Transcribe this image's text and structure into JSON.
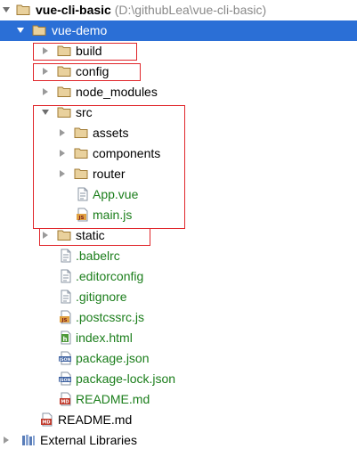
{
  "tree": {
    "root": {
      "name": "vue-cli-basic",
      "path": "(D:\\githubLea\\vue-cli-basic)"
    },
    "project": {
      "name": "vue-demo"
    },
    "items": {
      "build": "build",
      "config": "config",
      "node_modules": "node_modules",
      "src": "src",
      "assets": "assets",
      "components": "components",
      "router": "router",
      "app_vue": "App.vue",
      "main_js": "main.js",
      "static": "static",
      "babelrc": ".babelrc",
      "editorconfig": ".editorconfig",
      "gitignore": ".gitignore",
      "postcssrc": ".postcssrc.js",
      "index_html": "index.html",
      "package_json": "package.json",
      "package_lock": "package-lock.json",
      "readme_inner": "README.md",
      "readme_outer": "README.md",
      "external_libraries": "External Libraries"
    }
  },
  "colors": {
    "selection": "#2b6fd6",
    "folder": "#d9b66b",
    "highlight_box": "#e0262b",
    "modified_text": "#1b7e1b"
  },
  "icons": {
    "folder": "folder-icon",
    "vue_file": "vue-file-icon",
    "js_file": "js-file-icon",
    "config_file": "text-file-icon",
    "html_file": "html-file-icon",
    "json_file": "json-file-icon",
    "markdown_file": "markdown-file-icon",
    "library": "library-icon",
    "expand": "chevron-right-icon",
    "collapse": "chevron-down-icon"
  }
}
